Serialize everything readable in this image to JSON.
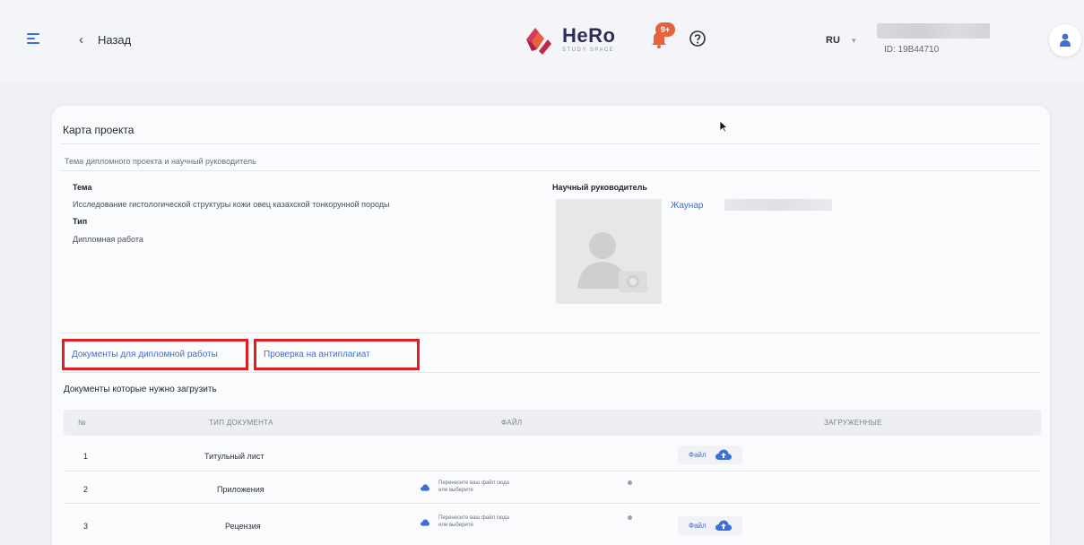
{
  "header": {
    "back_label": "Назад",
    "logo_title": "HeRo",
    "logo_subtitle": "STUDY SPACE",
    "notification_badge": "9+",
    "language": "RU",
    "user_id": "ID: 19B44710"
  },
  "card": {
    "title": "Карта проекта",
    "section_subtitle": "Тема дипломного проекта и научный руководитель",
    "topic_label": "Тема",
    "topic_value": "Исследование гистологической структуры кожи овец казахской тонкорунной породы",
    "type_label": "Тип",
    "type_value": "Дипломная работа",
    "supervisor_label": "Научный руководитель",
    "supervisor_name": "Жаунар"
  },
  "tabs": [
    {
      "label": "Документы для дипломной работы"
    },
    {
      "label": "Проверка на антиплагиат"
    }
  ],
  "documents": {
    "title": "Документы которые нужно загрузить",
    "columns": [
      "№",
      "ТИП ДОКУМЕНТА",
      "ФАЙЛ",
      "ЗАГРУЖЕННЫЕ"
    ],
    "rows": [
      {
        "num": "1",
        "type": "Титульный лист",
        "drop_text": "",
        "uploaded": "Файл"
      },
      {
        "num": "2",
        "type": "Приложения",
        "drop_text": "Перенесите ваш файл сюда или выберите",
        "uploaded": ""
      },
      {
        "num": "3",
        "type": "Рецензия",
        "drop_text": "Перенесите ваш файл сюда или выберите",
        "uploaded": "Файл"
      }
    ]
  },
  "colors": {
    "accent": "#3d6fd9",
    "highlight": "#e11d1d",
    "badge": "#e8613d"
  }
}
